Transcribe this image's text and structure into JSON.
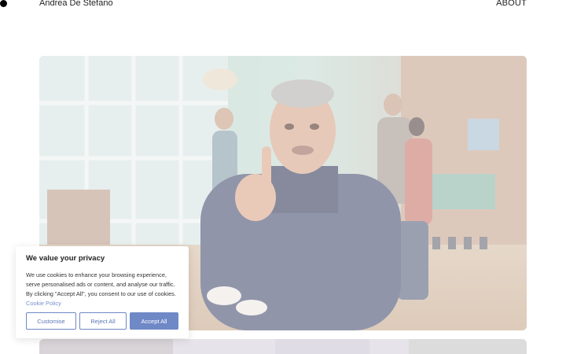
{
  "header": {
    "name": "Andrea De Stefano",
    "nav_about": "ABOUT"
  },
  "hero": {
    "image_icon": "photo-image-icon"
  },
  "cookie_banner": {
    "title": "We value your privacy",
    "body": "We use cookies to enhance your browsing experience, serve personalised ads or content, and analyse our traffic. By clicking \"Accept All\", you consent to our use of cookies.",
    "policy_link": "Cookie Policy",
    "customise": "Customise",
    "reject": "Reject All",
    "accept": "Accept All",
    "accent_color": "#6f88c6"
  }
}
